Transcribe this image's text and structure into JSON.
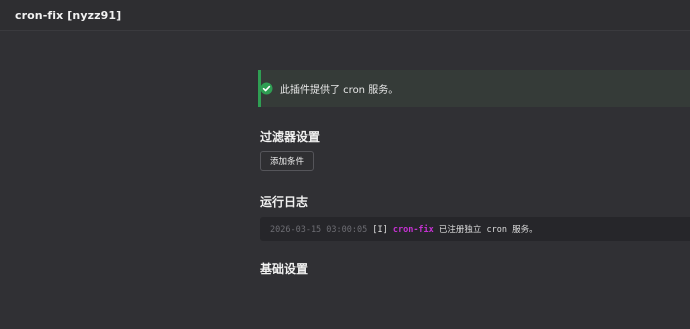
{
  "window": {
    "title": "cron-fix [nyzz91]"
  },
  "notice": {
    "icon": "check-circle-icon",
    "text": "此插件提供了 cron 服务。",
    "accent_color": "#2f9e53"
  },
  "filter_section": {
    "title": "过滤器设置",
    "add_condition_label": "添加条件"
  },
  "log_section": {
    "title": "运行日志",
    "entries": [
      {
        "timestamp": "2026-03-15 03:00:05",
        "level": "[I]",
        "plugin": "cron-fix",
        "message": "已注册独立 cron 服务。"
      }
    ]
  },
  "basic_section": {
    "title": "基础设置"
  }
}
